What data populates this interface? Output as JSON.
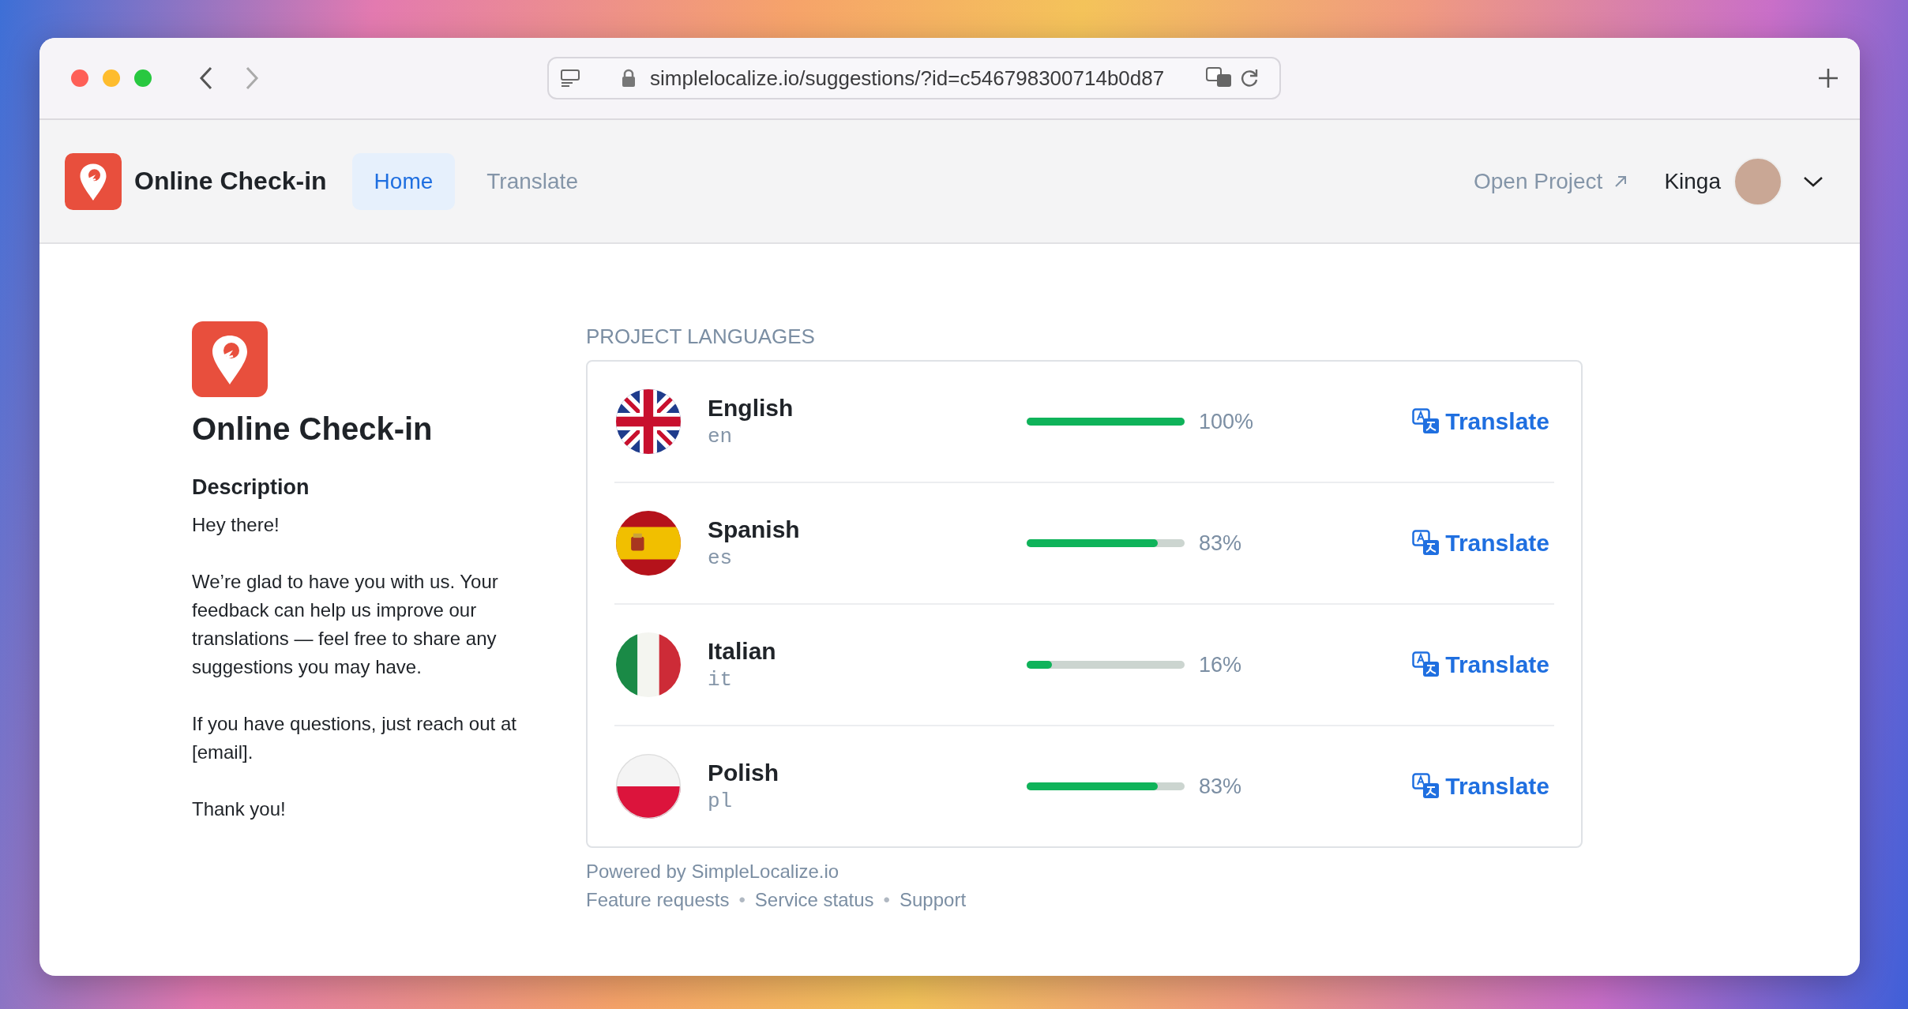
{
  "browser": {
    "url": "simplelocalize.io/suggestions/?id=c546798300714b0d87"
  },
  "header": {
    "app_name": "Online Check-in",
    "nav": [
      {
        "label": "Home",
        "selected": true
      },
      {
        "label": "Translate",
        "selected": false
      }
    ],
    "open_project": "Open Project",
    "user": "Kinga"
  },
  "project": {
    "name": "Online Check-in",
    "description_heading": "Description",
    "paragraphs": [
      "Hey there!",
      "We’re glad to have you with us. Your feedback can help us improve our translations — feel free to share any suggestions you may have.",
      "If you have questions, just reach out at [email].",
      "Thank you!"
    ]
  },
  "languages": {
    "heading": "PROJECT LANGUAGES",
    "items": [
      {
        "name": "English",
        "code": "en",
        "kind": "gb",
        "level": 1,
        "percent": "100%",
        "action": "Translate"
      },
      {
        "name": "Spanish",
        "code": "es",
        "kind": "es",
        "level": 0.83,
        "percent": "83%",
        "action": "Translate"
      },
      {
        "name": "Italian",
        "code": "it",
        "kind": "it",
        "level": 0.16,
        "percent": "16%",
        "action": "Translate"
      },
      {
        "name": "Polish",
        "code": "pl",
        "kind": "pl",
        "level": 0.83,
        "percent": "83%",
        "action": "Translate"
      }
    ]
  },
  "footer": {
    "powered": "Powered by SimpleLocalize.io",
    "links": [
      "Feature requests",
      "Service status",
      "Support"
    ],
    "separator": "•"
  }
}
